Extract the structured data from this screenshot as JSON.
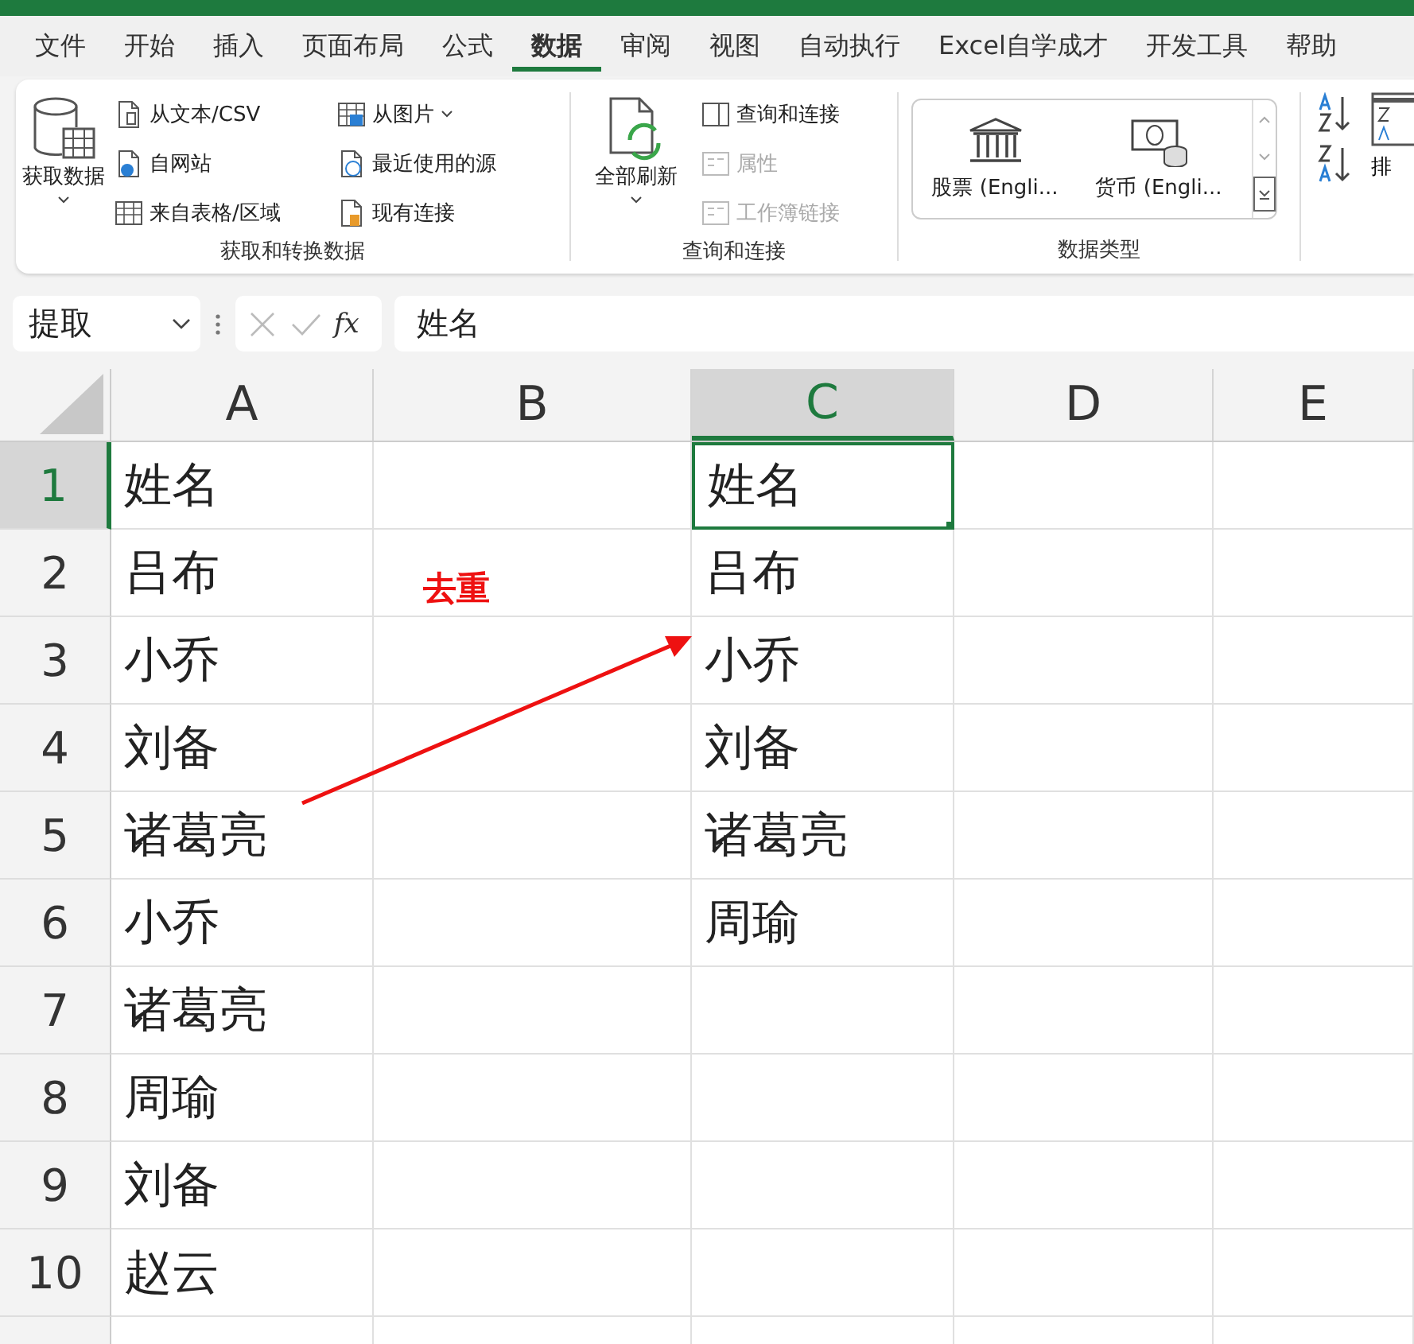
{
  "tabs": [
    {
      "label": "文件",
      "selected": false
    },
    {
      "label": "开始",
      "selected": false
    },
    {
      "label": "插入",
      "selected": false
    },
    {
      "label": "页面布局",
      "selected": false
    },
    {
      "label": "公式",
      "selected": false
    },
    {
      "label": "数据",
      "selected": true
    },
    {
      "label": "审阅",
      "selected": false
    },
    {
      "label": "视图",
      "selected": false
    },
    {
      "label": "自动执行",
      "selected": false
    },
    {
      "label": "Excel自学成才",
      "selected": false
    },
    {
      "label": "开发工具",
      "selected": false
    },
    {
      "label": "帮助",
      "selected": false
    }
  ],
  "ribbon": {
    "get_transform": {
      "title": "获取和转换数据",
      "large": {
        "label": "获取数据",
        "dropdown": true
      },
      "items": [
        {
          "label": "从文本/CSV",
          "dropdown": false
        },
        {
          "label": "自网站",
          "dropdown": false
        },
        {
          "label": "来自表格/区域",
          "dropdown": false
        },
        {
          "label": "从图片",
          "dropdown": true
        },
        {
          "label": "最近使用的源",
          "dropdown": false
        },
        {
          "label": "现有连接",
          "dropdown": false
        }
      ]
    },
    "queries": {
      "title": "查询和连接",
      "large": {
        "label": "全部刷新",
        "dropdown": true
      },
      "items": [
        {
          "label": "查询和连接",
          "disabled": false
        },
        {
          "label": "属性",
          "disabled": true
        },
        {
          "label": "工作簿链接",
          "disabled": true
        }
      ]
    },
    "data_types": {
      "title": "数据类型",
      "items": [
        "股票 (Engli...",
        "货币 (Engli..."
      ]
    },
    "sort": {
      "label": "排"
    }
  },
  "formula_bar": {
    "name_box": "提取",
    "fx": "fx",
    "formula": "姓名"
  },
  "columns": [
    {
      "label": "A",
      "selected": false
    },
    {
      "label": "B",
      "selected": false
    },
    {
      "label": "C",
      "selected": true
    },
    {
      "label": "D",
      "selected": false
    },
    {
      "label": "E",
      "selected": false
    }
  ],
  "rows": [
    {
      "number": "1",
      "selected": true,
      "a": "姓名",
      "c": "姓名"
    },
    {
      "number": "2",
      "selected": false,
      "a": "吕布",
      "c": "吕布"
    },
    {
      "number": "3",
      "selected": false,
      "a": "小乔",
      "c": "小乔"
    },
    {
      "number": "4",
      "selected": false,
      "a": "刘备",
      "c": "刘备"
    },
    {
      "number": "5",
      "selected": false,
      "a": "诸葛亮",
      "c": "诸葛亮"
    },
    {
      "number": "6",
      "selected": false,
      "a": "小乔",
      "c": "周瑜"
    },
    {
      "number": "7",
      "selected": false,
      "a": "诸葛亮"
    },
    {
      "number": "8",
      "selected": false,
      "a": "周瑜"
    },
    {
      "number": "9",
      "selected": false,
      "a": "刘备"
    },
    {
      "number": "10",
      "selected": false,
      "a": "赵云"
    }
  ],
  "annotation": {
    "text": "去重",
    "color": "#ee1111"
  }
}
